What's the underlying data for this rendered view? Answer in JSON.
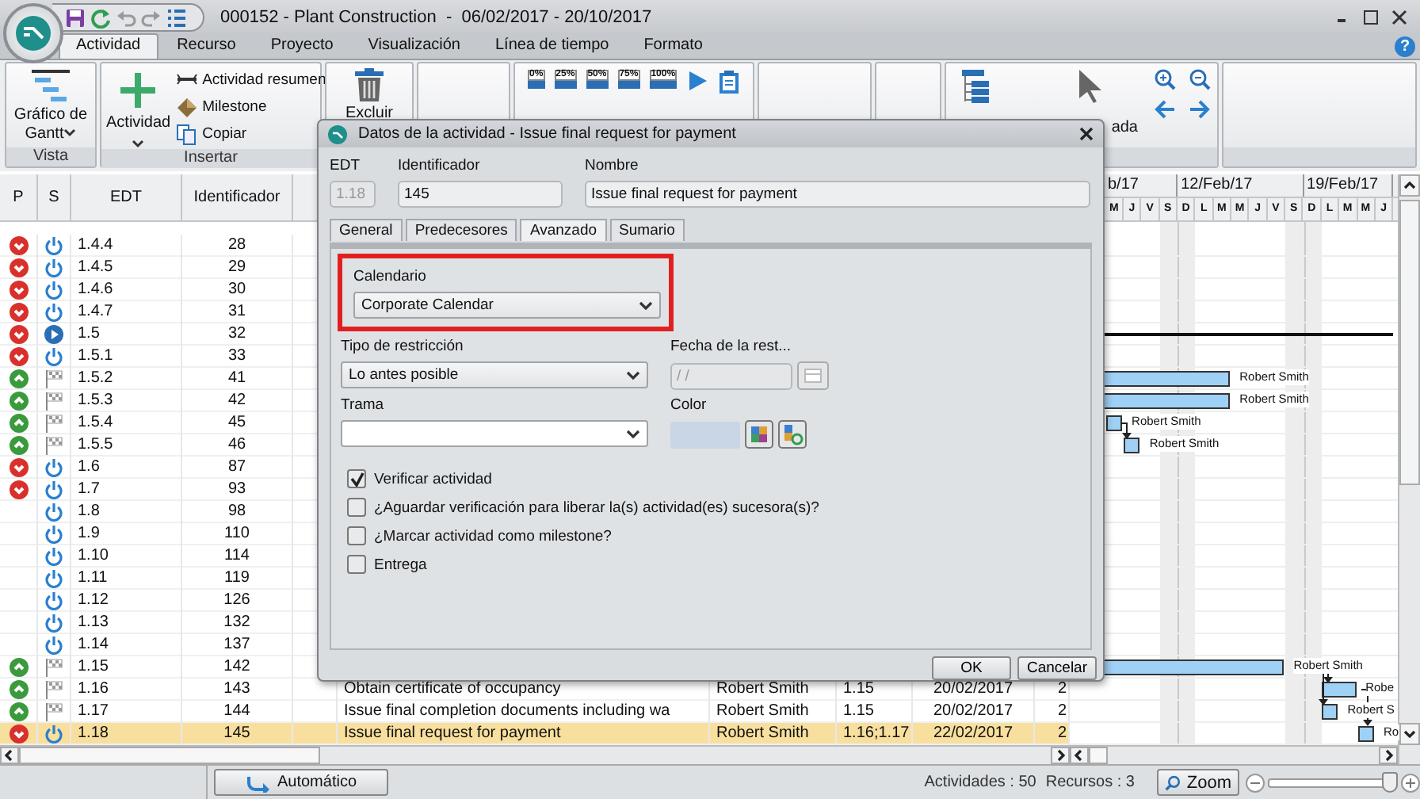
{
  "window": {
    "title": "000152 - Plant Construction  -  06/02/2017 - 20/10/2017"
  },
  "ribbon_tabs": [
    {
      "label": "Actividad",
      "selected": true
    },
    {
      "label": "Recurso",
      "selected": false
    },
    {
      "label": "Proyecto",
      "selected": false
    },
    {
      "label": "Visualización",
      "selected": false
    },
    {
      "label": "Línea de tiempo",
      "selected": false
    },
    {
      "label": "Formato",
      "selected": false
    }
  ],
  "help_button": "?",
  "ribbon": {
    "vista": {
      "button": "Gráfico de Gantt",
      "label": "Vista"
    },
    "insertar": {
      "button": "Actividad",
      "items": [
        "Actividad resumen",
        "Milestone",
        "Copiar"
      ],
      "label": "Insertar"
    },
    "delete_button": "Excluir",
    "progress_buttons": [
      "0%",
      "25%",
      "50%",
      "75%",
      "100%"
    ],
    "view_caption": "ada"
  },
  "table": {
    "columns": [
      "P",
      "S",
      "EDT",
      "Identificador"
    ],
    "rows": [
      {
        "p": {
          "kind": "down"
        },
        "s": {
          "kind": "power"
        },
        "edt": "1.4.4",
        "id": "28",
        "selected": false
      },
      {
        "p": {
          "kind": "down"
        },
        "s": {
          "kind": "power"
        },
        "edt": "1.4.5",
        "id": "29",
        "selected": false
      },
      {
        "p": {
          "kind": "down"
        },
        "s": {
          "kind": "power"
        },
        "edt": "1.4.6",
        "id": "30",
        "selected": false
      },
      {
        "p": {
          "kind": "down"
        },
        "s": {
          "kind": "power"
        },
        "edt": "1.4.7",
        "id": "31",
        "selected": false
      },
      {
        "p": {
          "kind": "down"
        },
        "s": {
          "kind": "play"
        },
        "edt": "1.5",
        "id": "32",
        "selected": false,
        "bar": {
          "kind": "summary"
        }
      },
      {
        "p": {
          "kind": "down"
        },
        "s": {
          "kind": "power"
        },
        "edt": "1.5.1",
        "id": "33",
        "selected": false
      },
      {
        "p": {
          "kind": "up"
        },
        "s": {
          "kind": "flag"
        },
        "edt": "1.5.2",
        "id": "41",
        "selected": false,
        "bar": {
          "kind": "task",
          "label": "Robert Smith"
        }
      },
      {
        "p": {
          "kind": "up"
        },
        "s": {
          "kind": "flag"
        },
        "edt": "1.5.3",
        "id": "42",
        "selected": false,
        "bar": {
          "kind": "task",
          "label": "Robert Smith"
        }
      },
      {
        "p": {
          "kind": "up"
        },
        "s": {
          "kind": "flag"
        },
        "edt": "1.5.4",
        "id": "45",
        "selected": false,
        "bar": {
          "kind": "task",
          "label": "Robert Smith"
        }
      },
      {
        "p": {
          "kind": "up"
        },
        "s": {
          "kind": "flag"
        },
        "edt": "1.5.5",
        "id": "46",
        "selected": false,
        "bar": {
          "kind": "task",
          "label": "Robert Smith"
        }
      },
      {
        "p": {
          "kind": "down"
        },
        "s": {
          "kind": "power"
        },
        "edt": "1.6",
        "id": "87",
        "selected": false
      },
      {
        "p": {
          "kind": "down"
        },
        "s": {
          "kind": "power"
        },
        "edt": "1.7",
        "id": "93",
        "selected": false
      },
      {
        "s": {
          "kind": "power"
        },
        "edt": "1.8",
        "id": "98",
        "selected": false
      },
      {
        "s": {
          "kind": "power"
        },
        "edt": "1.9",
        "id": "110",
        "selected": false
      },
      {
        "s": {
          "kind": "power"
        },
        "edt": "1.10",
        "id": "114",
        "selected": false
      },
      {
        "s": {
          "kind": "power"
        },
        "edt": "1.11",
        "id": "119",
        "selected": false
      },
      {
        "s": {
          "kind": "power"
        },
        "edt": "1.12",
        "id": "126",
        "selected": false
      },
      {
        "s": {
          "kind": "power"
        },
        "edt": "1.13",
        "id": "132",
        "selected": false
      },
      {
        "s": {
          "kind": "power"
        },
        "edt": "1.14",
        "id": "137",
        "selected": false
      },
      {
        "p": {
          "kind": "up"
        },
        "s": {
          "kind": "flag"
        },
        "edt": "1.15",
        "id": "142",
        "selected": false,
        "bar": {
          "kind": "task",
          "label": "Robert Smith"
        }
      },
      {
        "p": {
          "kind": "up"
        },
        "s": {
          "kind": "flag"
        },
        "edt": "1.16",
        "id": "143",
        "selected": false,
        "name": "Obtain certificate of occupancy",
        "resource": "Robert Smith",
        "predecessors": "1.15",
        "start": "20/02/2017",
        "column_9": "2",
        "bar": {
          "kind": "task",
          "label": "Robe"
        }
      },
      {
        "p": {
          "kind": "up"
        },
        "s": {
          "kind": "flag"
        },
        "edt": "1.17",
        "id": "144",
        "selected": false,
        "name": "Issue final completion documents including wa",
        "resource": "Robert Smith",
        "predecessors": "1.15",
        "start": "20/02/2017",
        "column_9": "2",
        "bar": {
          "kind": "task",
          "label": "Robert S"
        }
      },
      {
        "p": {
          "kind": "down"
        },
        "s": {
          "kind": "power"
        },
        "edt": "1.18",
        "id": "145",
        "selected": true,
        "name": "Issue final request for payment",
        "resource": "Robert Smith",
        "predecessors": "1.16;1.17",
        "start": "22/02/2017",
        "column_9": "2",
        "bar": {
          "kind": "task",
          "label": "Ro"
        }
      }
    ]
  },
  "gantt": {
    "weeks": [
      {
        "label": "b/17",
        "days": [
          {
            "label": "M",
            "weekend": false
          },
          {
            "label": "J",
            "weekend": false
          },
          {
            "label": "V",
            "weekend": false
          },
          {
            "label": "S",
            "weekend": true
          }
        ]
      },
      {
        "label": "12/Feb/17",
        "days": [
          {
            "label": "D",
            "weekend": true
          },
          {
            "label": "L",
            "weekend": false
          },
          {
            "label": "M",
            "weekend": false
          },
          {
            "label": "M",
            "weekend": false
          },
          {
            "label": "J",
            "weekend": false
          },
          {
            "label": "V",
            "weekend": false
          },
          {
            "label": "S",
            "weekend": true
          }
        ]
      },
      {
        "label": "19/Feb/17",
        "days": [
          {
            "label": "D",
            "weekend": true
          },
          {
            "label": "L",
            "weekend": false
          },
          {
            "label": "M",
            "weekend": false
          },
          {
            "label": "M",
            "weekend": false
          },
          {
            "label": "J",
            "weekend": false
          }
        ]
      }
    ]
  },
  "dialog": {
    "title": "Datos de la actividad - Issue final request for payment",
    "edt": {
      "label": "EDT",
      "value": "1.18",
      "disabled": true
    },
    "identifier": {
      "label": "Identificador",
      "value": "145"
    },
    "name": {
      "label": "Nombre",
      "value": "Issue final request for payment"
    },
    "tabs": [
      {
        "label": "General",
        "selected": false
      },
      {
        "label": "Predecesores",
        "selected": false
      },
      {
        "label": "Avanzado",
        "selected": true
      },
      {
        "label": "Sumario",
        "selected": false
      }
    ],
    "calendar": {
      "label": "Calendario",
      "value": "Corporate Calendar",
      "highlighted": true
    },
    "restriction": {
      "label": "Tipo de restricción",
      "value": "Lo antes posible"
    },
    "restriction_date": {
      "label": "Fecha de la rest...",
      "value": "/ /",
      "disabled": true
    },
    "pattern": {
      "label": "Trama"
    },
    "color": {
      "label": "Color"
    },
    "checks": [
      {
        "label": "Verificar actividad",
        "checked": true
      },
      {
        "label": "¿Aguardar verificación para liberar la(s) actividad(es) sucesora(s)?",
        "checked": false
      },
      {
        "label": "¿Marcar actividad como milestone?",
        "checked": false
      },
      {
        "label": "Entrega",
        "checked": false
      }
    ],
    "buttons": [
      "OK",
      "Cancelar"
    ]
  },
  "status_bar": {
    "mode_button": "Automático",
    "activities": "Actividades : 50",
    "resources": "Recursos : 3",
    "zoom_button": "Zoom",
    "zoom": {
      "level": 0.95
    }
  }
}
